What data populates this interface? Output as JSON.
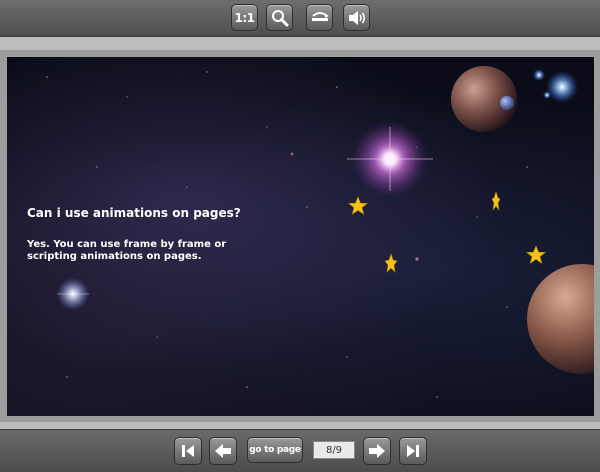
{
  "toolbar": {
    "zoom_actual_label": "1:1",
    "icons": [
      "magnifier-icon",
      "flip-icon",
      "speaker-icon"
    ]
  },
  "page": {
    "question": "Can i use animations on pages?",
    "answer": "Yes. You can use frame by frame or scripting animations on pages."
  },
  "navigation": {
    "goto_label": "go to page",
    "page_indicator": "8/9",
    "icons": [
      "first-page-icon",
      "previous-page-icon",
      "next-page-icon",
      "last-page-icon"
    ]
  },
  "colors": {
    "toolbar_bg": "#5a5a5a",
    "frame_bg": "#bdbdbd",
    "space_bg": "#0b0c18",
    "star_yellow": "#f2c21a",
    "text": "#ffffff"
  }
}
